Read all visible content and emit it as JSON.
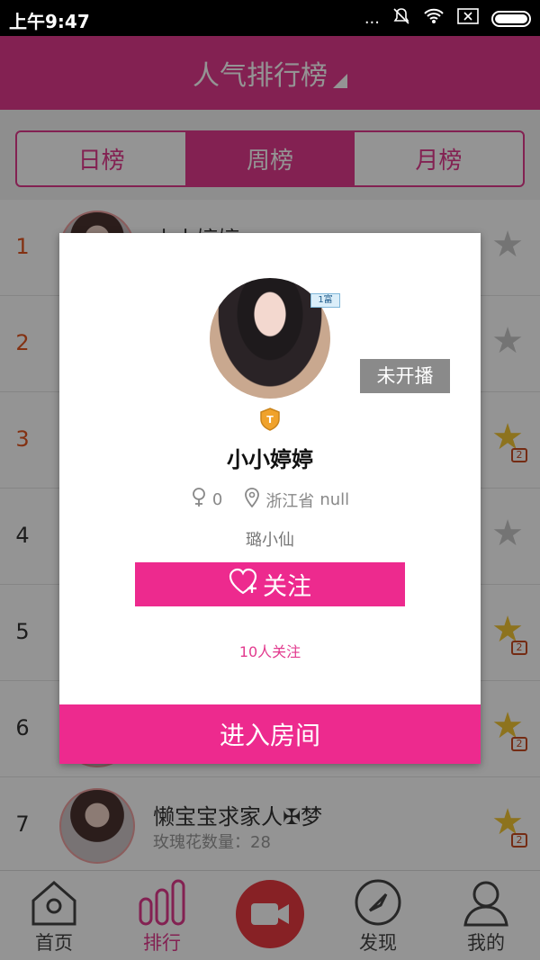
{
  "status_bar": {
    "time": "上午9:47",
    "dots": "...",
    "mute_icon": "bell-off-icon",
    "wifi_icon": "wifi-icon",
    "sim_icon": "sim-x-icon",
    "battery_icon": "battery-icon"
  },
  "header": {
    "title": "人气排行榜"
  },
  "tabs": [
    {
      "label": "日榜",
      "active": false
    },
    {
      "label": "周榜",
      "active": true
    },
    {
      "label": "月榜",
      "active": false
    }
  ],
  "list": [
    {
      "rank": "1",
      "name": "小小婷婷",
      "sub": ""
    },
    {
      "rank": "2",
      "name": "",
      "sub": ""
    },
    {
      "rank": "3",
      "name": "",
      "sub": ""
    },
    {
      "rank": "4",
      "name": "",
      "sub": ""
    },
    {
      "rank": "5",
      "name": "",
      "sub": ""
    },
    {
      "rank": "6",
      "name": "",
      "sub": ""
    },
    {
      "rank": "7",
      "name": "懒宝宝求家人✠梦",
      "sub": "玫瑰花数量：28"
    }
  ],
  "bottom_nav": [
    {
      "label": "首页",
      "icon": "home-icon"
    },
    {
      "label": "排行",
      "icon": "ranking-icon"
    },
    {
      "label": "",
      "icon": "video-camera-icon"
    },
    {
      "label": "发现",
      "icon": "compass-icon"
    },
    {
      "label": "我的",
      "icon": "user-icon"
    }
  ],
  "dialog": {
    "rich_badge": "1富",
    "live_status": "未开播",
    "name": "小小婷婷",
    "gender_count": "0",
    "location": "浙江省",
    "location_extra": "null",
    "signature": "璐小仙",
    "follow_label": "关注",
    "follow_count": "10人关注",
    "enter_room_label": "进入房间"
  },
  "colors": {
    "accent": "#e23a8e",
    "button": "#ed2a8e",
    "status_gray": "#8a8a8a",
    "camera": "#e83a40"
  }
}
